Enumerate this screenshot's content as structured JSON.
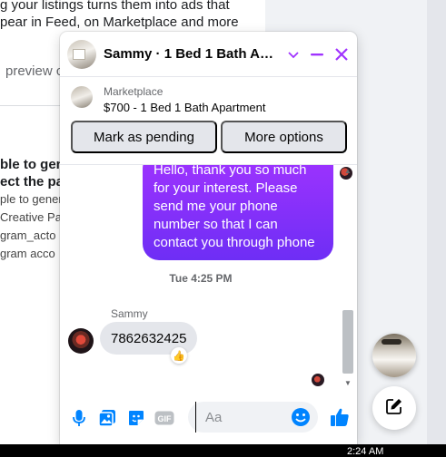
{
  "background_page": {
    "lines": [
      "g your listings turns them into ads that",
      "pear in Feed, on Marketplace and more",
      "preview c",
      "ble to gen",
      "ect the pa",
      "ple to gener",
      "Creative Par",
      "gram_acto",
      "gram acco"
    ]
  },
  "chat": {
    "title": "Sammy · 1 Bed 1 Bath Apartment",
    "listing_source": "Marketplace",
    "listing_title": "$700 - 1 Bed 1 Bath Apartment",
    "mark_pending_label": "Mark as pending",
    "more_options_label": "More options",
    "outgoing_message": "Hello, thank you so much for your interest. Please send me your phone number so that I can contact you through phone",
    "timestamp": "Tue 4:25 PM",
    "sender_name": "Sammy",
    "incoming_message": "7862632425",
    "reaction": "👍",
    "composer_placeholder": "Aa"
  },
  "icons": {
    "chevron": "chevron-down-icon",
    "minimize": "minimize-icon",
    "close": "close-icon",
    "mic": "microphone-icon",
    "photo": "photo-icon",
    "sticker": "sticker-icon",
    "gif": "gif-icon",
    "emoji": "emoji-icon",
    "like": "thumbs-up-icon",
    "compose": "new-message-icon"
  },
  "colors": {
    "accent": "#a033ff",
    "messenger_blue": "#0084ff"
  },
  "taskbar": {
    "time": "2:24 AM"
  }
}
